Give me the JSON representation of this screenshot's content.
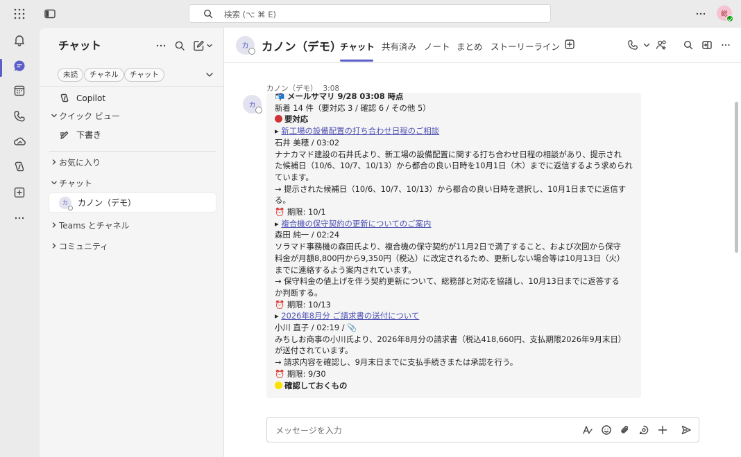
{
  "topbar": {
    "search_placeholder": "検索 (⌥ ⌘ E)",
    "user_initial": "総"
  },
  "rail": {
    "items": [
      "bell-icon",
      "chat-icon",
      "calendar-icon",
      "call-icon",
      "onedrive-icon",
      "copilot-icon",
      "add-apps-icon",
      "more-icon"
    ],
    "active": "chat-icon"
  },
  "panel": {
    "title": "チャット",
    "filters": [
      "未読",
      "チャネル",
      "チャット"
    ],
    "copilot": "Copilot",
    "quick_view": "クイック ビュー",
    "drafts": "下書き",
    "favorites": "お気に入り",
    "chats_section": "チャット",
    "chat_item": {
      "avatar": "カ",
      "name": "カノン（デモ）"
    },
    "teams_channels": "Teams とチャネル",
    "community": "コミュニティ"
  },
  "header": {
    "avatar": "カ",
    "title": "カノン（デモ）",
    "tabs": [
      "チャット",
      "共有済み",
      "ノート",
      "まとめ",
      "ストーリーライン"
    ],
    "active_tab": "チャット"
  },
  "message": {
    "avatar": "カ",
    "sender": "カノン（デモ）",
    "time": "3:08",
    "lines": {
      "l1_icon": "📬",
      "l1": "メールサマリ 9/28 03:08 時点",
      "l2": "新着 14 件（要対応 3 / 確認 6 / その他 5）",
      "l3": "要対応",
      "l4_bullet": "▸",
      "l4_link": "新工場の設備配置の打ち合わせ日程のご相談",
      "l5": "石井 美穂 / 03:02",
      "l6": "ナナカマド建設の石井氏より、新工場の設備配置に関する打ち合わせ日程の相談があり、提示され",
      "l7": "た候補日（10/6、10/7、10/13）から都合の良い日時を10月1日（木）までに返信するよう求められ",
      "l8": "ています。",
      "l9": "→ 提示された候補日（10/6、10/7、10/13）から都合の良い日時を選択し、10月1日までに返信す",
      "l10": "る。",
      "l11_icon": "⏰",
      "l11": "期限: 10/1",
      "l12_bullet": "▸",
      "l12_link": "複合機の保守契約の更新についてのご案内",
      "l13": "森田 純一 / 02:24",
      "l14": "ソラマド事務機の森田氏より、複合機の保守契約が11月2日で満了すること、および次回から保守",
      "l15": "料金が月額8,800円から9,350円（税込）に改定されるため、更新しない場合等は10月13日（火）",
      "l16": "までに連絡するよう案内されています。",
      "l17": "→ 保守料金の値上げを伴う契約更新について、総務部と対応を協議し、10月13日までに返答する",
      "l18": "か判断する。",
      "l19_icon": "⏰",
      "l19": "期限: 10/13",
      "l20_bullet": "▸",
      "l20_link": "2026年8月分 ご請求書の送付について",
      "l21": "小川 直子 / 02:19 / 📎",
      "l22": "みちしお商事の小川氏より、2026年8月分の請求書（税込418,660円、支払期限2026年9月末日）",
      "l23": "が送付されています。",
      "l24": "→ 請求内容を確認し、9月末日までに支払手続きまたは承認を行う。",
      "l25_icon": "⏰",
      "l25": "期限: 9/30",
      "l26": "確認しておくもの"
    }
  },
  "composer": {
    "placeholder": "メッセージを入力"
  },
  "colors": {
    "accent": "#5b5fc7",
    "link": "#4f52b2",
    "urgent_dot": "#d13438",
    "confirm_dot": "#fce100",
    "presence": "#13a10e"
  }
}
